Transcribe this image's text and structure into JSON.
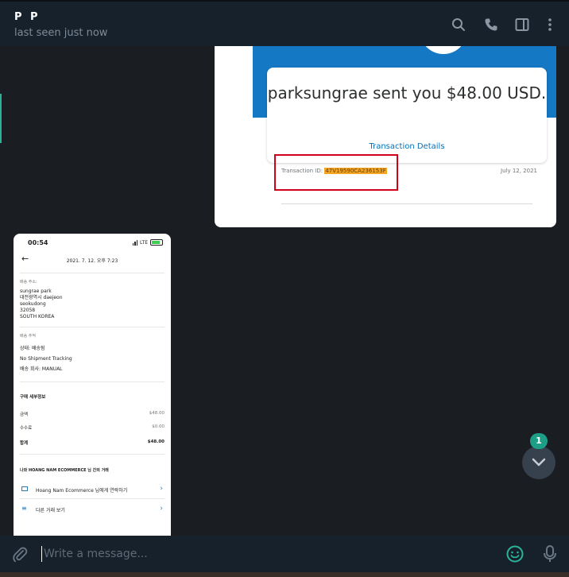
{
  "header": {
    "title": "P P",
    "status": "last seen just now",
    "icons": [
      "search-icon",
      "phone-icon",
      "sidebar-toggle-icon",
      "more-vertical-icon"
    ]
  },
  "receipt": {
    "sent_text": "parksungrae sent you $48.00 USD.",
    "transaction_details_link": "Transaction Details",
    "transaction_id_label": "Transaction ID:",
    "transaction_id": "47V19590CA236153F",
    "date": "July 12, 2021",
    "highlight_color": "#d0021b"
  },
  "phone": {
    "time": "00:54",
    "network": "LTE",
    "datetime": "2021. 7. 12.  오후 7:23",
    "shipping_address_label": "배송 주소:",
    "address_lines": [
      "sungrae park",
      "대전광역시 daejeon",
      "seokudong",
      "32058",
      "SOUTH KOREA"
    ],
    "tracking_label": "배송 추적",
    "tracking_lines": [
      "상태: 배송됨",
      "No Shipment Tracking",
      "배송 회사: MANUAL"
    ],
    "purchase_details_label": "구매 세부정보",
    "amount_label": "금액",
    "amount_value": "$48.00",
    "fee_label": "수수료",
    "fee_value": "$0.00",
    "total_label": "합계",
    "total_value": "$48.00",
    "transaction_with": "나와 HOANG NAM ECOMMERCE 님 간의 거래",
    "contact_link": "Hoang Nam Ecommerce 님에게 연락하기",
    "other_link": "다른 거래 보기"
  },
  "scroll": {
    "unread_count": "1"
  },
  "composer": {
    "placeholder": "Write a message..."
  },
  "colors": {
    "accent": "#1d9e87",
    "header_bg": "#17212b",
    "chat_bg": "#1a1d22"
  }
}
